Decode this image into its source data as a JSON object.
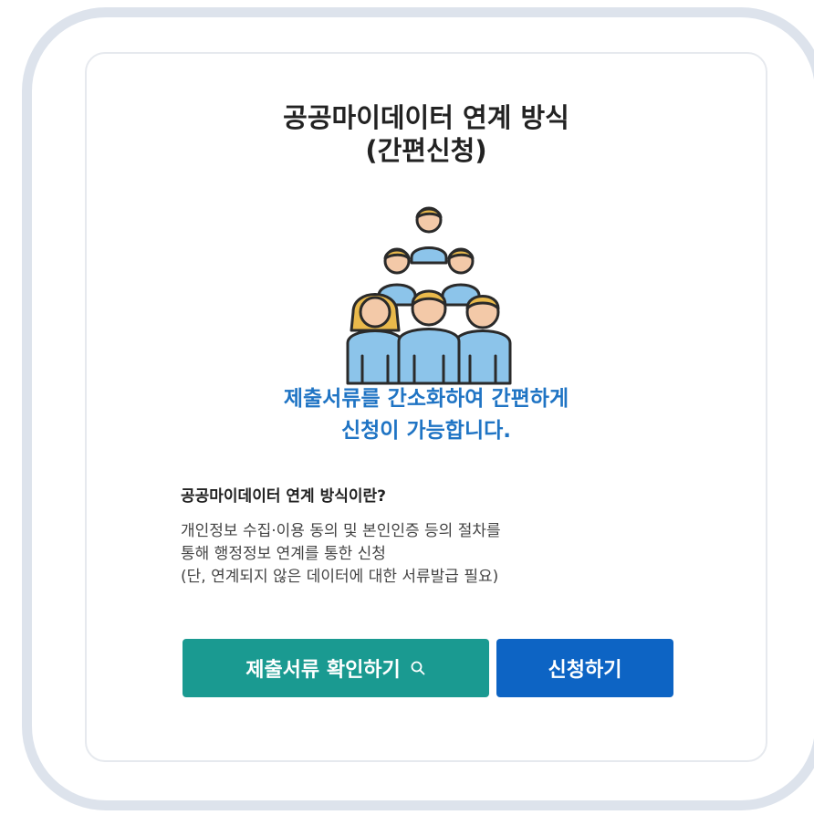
{
  "card": {
    "title_line1": "공공마이데이터 연계 방식",
    "title_line2": "(간편신청)",
    "illustration_icon": "group-of-people-icon",
    "highlight_line1": "제출서류를 간소화하여 간편하게",
    "highlight_line2": "신청이 가능합니다.",
    "subheading": "공공마이데이터 연계 방식이란?",
    "desc_line1": "개인정보 수집·이용 동의 및 본인인증 등의 절차를",
    "desc_line2": "통해 행정정보 연계를 통한 신청",
    "desc_line3": "(단, 연계되지 않은 데이터에 대한 서류발급 필요)"
  },
  "buttons": {
    "docs_label": "제출서류 확인하기",
    "docs_icon": "search-icon",
    "apply_label": "신청하기"
  },
  "colors": {
    "title": "#222222",
    "highlight": "#1f74c4",
    "docs_button": "#1a9a91",
    "apply_button": "#0d64c4",
    "frame_border": "#dde3ec"
  }
}
